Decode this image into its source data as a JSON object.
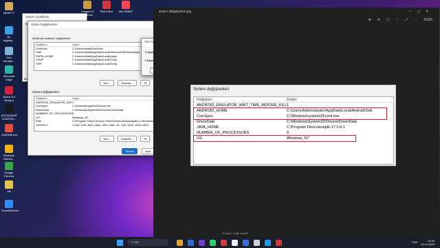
{
  "desktop": {
    "icons": [
      {
        "label": "Mikail T?",
        "color": "#d9a95b"
      },
      {
        "label": "Bu bilgisay...",
        "color": "#3aa0e8"
      },
      {
        "label": "Geri Dönüşü...",
        "color": "#7fb3d5"
      },
      {
        "label": "Microsoft Edge",
        "color": "#2bb3a3"
      },
      {
        "label": "Opera GX Tarayıcı",
        "color": "#d4233c"
      },
      {
        "label": "EXCALIBUR CONTRO...",
        "color": "#1a1a1a"
      },
      {
        "label": "AnyDesk.exe",
        "color": "#e34f3c"
      },
      {
        "label": "Rockstar Games...",
        "color": "#f3b20b"
      },
      {
        "label": "Google Chrome",
        "color": "#37a24a"
      },
      {
        "label": "mil",
        "color": "#e8c34a"
      },
      {
        "label": "ZoomMeti.exe",
        "color": "#2d8cff"
      }
    ],
    "top_icons": [
      "League of Legends",
      "Riot Client",
      "VALORANT"
    ]
  },
  "sys_props": {
    "title": "Sistem Özellikleri",
    "tab": "Bilgisayar Adı",
    "side_labels": [
      "Başlat",
      "Sistem"
    ]
  },
  "env_dialog": {
    "title": "Ortam Değişkenleri",
    "user_section": "mikail için kullanıcı değişkenleri",
    "headers": [
      "Değişken",
      "Değer"
    ],
    "user_vars": [
      [
        "OneDrive",
        "C:\\Users\\mikail\\OneDrive"
      ],
      [
        "Path",
        "C:\\Users\\mikail\\AppData\\Local\\Microsoft\\WindowsApps;"
      ],
      [
        "PNPM_HOME",
        "C:\\Users\\mikail\\AppData\\Local\\pnpm"
      ],
      [
        "TEMP",
        "C:\\Users\\mikail\\AppData\\Local\\Temp"
      ],
      [
        "TMP",
        "C:\\Users\\mikail\\AppData\\Local\\Temp"
      ]
    ],
    "user_buttons": [
      "Yeni...",
      "Düzenle...",
      "Sil"
    ],
    "sys_section": "Sistem değişkenleri",
    "sys_vars": [
      [
        "ANDROID_EMULATOR_WAIT...",
        "1"
      ],
      [
        "ComSpec",
        "C:\\Windows\\system32\\cmd.exe"
      ],
      [
        "DriverData",
        "C:\\Windows\\System32\\Drivers\\DriverData"
      ],
      [
        "NUMBER_OF_PROCESSORS",
        "8"
      ],
      [
        "OS",
        "Windows_NT"
      ],
      [
        "Path",
        "C:\\Program Files\\Common Files\\Oracle\\Java\\javapath;C:\\Windows\\syst..."
      ],
      [
        "PATHEXT",
        ".COM;.EXE;.BAT;.CMD;.VBS;.VBE;.JS;.JSE;.WSF;.WSH;.MSC"
      ]
    ],
    "sys_buttons": [
      "Yeni...",
      "Düzenle...",
      "Sil"
    ],
    "ok": "Tamam",
    "cancel": "İptal"
  },
  "new_var_dialog": {
    "title": "Yeni Sistem Değişkeni",
    "name_label": "Değişken adı:",
    "name_value": "",
    "value_label": "Değişken değeri:",
    "value_value": "C:\\Users\\mikail\\AppData\\Local\\Android\\Sdk",
    "browse_dir": "Dizine Gözat...",
    "browse_file": "Dosyaya Gözat...",
    "ok": "Tamam",
    "cancel": "İptal"
  },
  "viewer": {
    "title": "sistem değişkenleri.png",
    "zoom": "%100",
    "tools": [
      "⊕",
      "⊖",
      "▢",
      "♡",
      "⤢",
      "…"
    ],
    "panel_title": "Sistem değişkenleri",
    "headers": [
      "Değişken",
      "Değer"
    ],
    "rows": [
      [
        "ANDROID_EMULATOR_WAIT_TIME_BEFORE_KILL",
        "1"
      ],
      [
        "ANDROID_HOME",
        "C:\\Users\\Administrator\\AppData\\Local\\Android\\Sdk"
      ],
      [
        "ComSpec",
        "C:\\Windows\\system32\\cmd.exe"
      ],
      [
        "DriverData",
        "C:\\Windows\\System32\\Drivers\\DriverData"
      ],
      [
        "JAVA_HOME",
        "C:\\Program Files\\Java\\jdk-17.0.4.1"
      ],
      [
        "NUMBER_OF_PROCESSORS",
        "8"
      ],
      [
        "OS",
        "Windows_NT"
      ]
    ],
    "status": "11 öğe  |  1 öğe seçildi"
  },
  "taskbar": {
    "search_placeholder": "Ara",
    "time": "13:30",
    "date": "11.12.2023",
    "lang": "TUR",
    "app_colors": [
      "#e4a327",
      "#2b6ad8",
      "#6b3fd1",
      "#25d366",
      "#d73a3a",
      "#f0f0f0",
      "#3a6ee8",
      "#d0d0d0",
      "#1e9be8",
      "#d43535"
    ]
  }
}
